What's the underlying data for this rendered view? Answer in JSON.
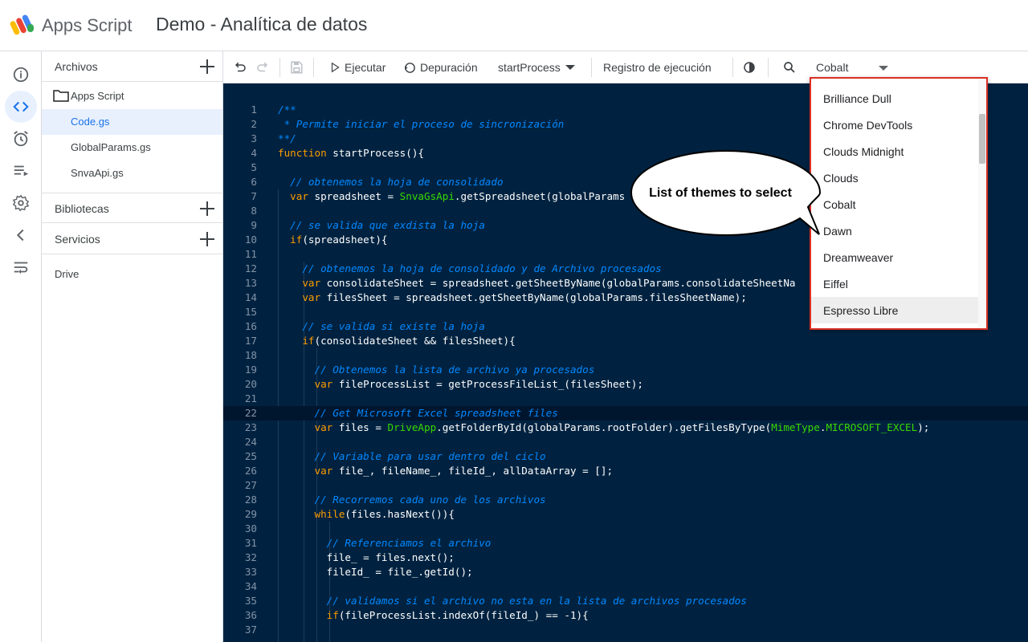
{
  "header": {
    "app_name": "Apps Script",
    "project_title": "Demo - Analítica de datos"
  },
  "rail": {
    "items": [
      {
        "icon": "info-icon",
        "label": "Overview"
      },
      {
        "icon": "code-icon",
        "label": "Editor"
      },
      {
        "icon": "alarm-clock-icon",
        "label": "Triggers"
      },
      {
        "icon": "executions-icon",
        "label": "Executions"
      },
      {
        "icon": "gear-icon",
        "label": "Settings"
      },
      {
        "icon": "chevron-left-icon",
        "label": "Collapse"
      },
      {
        "icon": "wrap-text-icon",
        "label": "Wrap"
      }
    ]
  },
  "files": {
    "section_title": "Archivos",
    "folder": "Apps Script",
    "items": [
      "Code.gs",
      "GlobalParams.gs",
      "SnvaApi.gs"
    ],
    "selected": "Code.gs",
    "libraries_title": "Bibliotecas",
    "services_title": "Servicios",
    "services_items": [
      "Drive"
    ]
  },
  "toolbar": {
    "run_label": "Ejecutar",
    "debug_label": "Depuración",
    "function_name": "startProcess",
    "log_label": "Registro de ejecución",
    "theme_value": "Cobalt"
  },
  "theme_dropdown": {
    "options": [
      "Brilliance Dull",
      "Chrome DevTools",
      "Clouds Midnight",
      "Clouds",
      "Cobalt",
      "Dawn",
      "Dreamweaver",
      "Eiffel",
      "Espresso Libre"
    ],
    "highlighted": "Espresso Libre",
    "border_color": "#d93025"
  },
  "callout": {
    "text": "List of themes to select"
  },
  "editor": {
    "theme_colors": {
      "background": "#002240",
      "comment": "#0088ff",
      "keyword": "#ff9d00",
      "global": "#3ad900"
    },
    "current_line": 22,
    "lines": [
      {
        "n": "1",
        "t": [
          [
            "c",
            "/**"
          ]
        ]
      },
      {
        "n": "2",
        "t": [
          [
            "c",
            " * Permite iniciar el proceso de sincronización"
          ]
        ]
      },
      {
        "n": "3",
        "t": [
          [
            "c",
            "**/"
          ]
        ]
      },
      {
        "n": "4",
        "t": [
          [
            "k",
            "function"
          ],
          [
            "p",
            " startProcess(){"
          ]
        ]
      },
      {
        "n": "5",
        "t": []
      },
      {
        "n": "6",
        "t": [
          [
            "p",
            "  "
          ],
          [
            "c",
            "// obtenemos la hoja de consolidado"
          ]
        ]
      },
      {
        "n": "7",
        "t": [
          [
            "p",
            "  "
          ],
          [
            "k",
            "var"
          ],
          [
            "p",
            " spreadsheet = "
          ],
          [
            "g",
            "SnvaGsApi"
          ],
          [
            "p",
            ".getSpreadsheet(globalParams"
          ]
        ]
      },
      {
        "n": "8",
        "t": []
      },
      {
        "n": "9",
        "t": [
          [
            "p",
            "  "
          ],
          [
            "c",
            "// se valida que exdista la hoja"
          ]
        ]
      },
      {
        "n": "10",
        "t": [
          [
            "p",
            "  "
          ],
          [
            "k",
            "if"
          ],
          [
            "p",
            "(spreadsheet){"
          ]
        ]
      },
      {
        "n": "11",
        "t": []
      },
      {
        "n": "12",
        "t": [
          [
            "p",
            "    "
          ],
          [
            "c",
            "// obtenemos la hoja de consolidado y de Archivo procesados"
          ]
        ]
      },
      {
        "n": "13",
        "t": [
          [
            "p",
            "    "
          ],
          [
            "k",
            "var"
          ],
          [
            "p",
            " consolidateSheet = spreadsheet.getSheetByName(globalParams.consolidateSheetNa"
          ]
        ]
      },
      {
        "n": "14",
        "t": [
          [
            "p",
            "    "
          ],
          [
            "k",
            "var"
          ],
          [
            "p",
            " filesSheet = spreadsheet.getSheetByName(globalParams.filesSheetName);"
          ]
        ]
      },
      {
        "n": "15",
        "t": []
      },
      {
        "n": "16",
        "t": [
          [
            "p",
            "    "
          ],
          [
            "c",
            "// se valida si existe la hoja"
          ]
        ]
      },
      {
        "n": "17",
        "t": [
          [
            "p",
            "    "
          ],
          [
            "k",
            "if"
          ],
          [
            "p",
            "(consolidateSheet && filesSheet){"
          ]
        ]
      },
      {
        "n": "18",
        "t": []
      },
      {
        "n": "19",
        "t": [
          [
            "p",
            "      "
          ],
          [
            "c",
            "// Obtenemos la lista de archivo ya procesados"
          ]
        ]
      },
      {
        "n": "20",
        "t": [
          [
            "p",
            "      "
          ],
          [
            "k",
            "var"
          ],
          [
            "p",
            " fileProcessList = getProcessFileList_(filesSheet);"
          ]
        ]
      },
      {
        "n": "21",
        "t": []
      },
      {
        "n": "22",
        "t": [
          [
            "p",
            "      "
          ],
          [
            "c",
            "// Get Microsoft Excel spreadsheet files"
          ]
        ]
      },
      {
        "n": "23",
        "t": [
          [
            "p",
            "      "
          ],
          [
            "k",
            "var"
          ],
          [
            "p",
            " files = "
          ],
          [
            "g",
            "DriveApp"
          ],
          [
            "p",
            ".getFolderById(globalParams.rootFolder).getFilesByType("
          ],
          [
            "g",
            "MimeType"
          ],
          [
            "p",
            "."
          ],
          [
            "g",
            "MICROSOFT_EXCEL"
          ],
          [
            "p",
            ");"
          ]
        ]
      },
      {
        "n": "24",
        "t": []
      },
      {
        "n": "25",
        "t": [
          [
            "p",
            "      "
          ],
          [
            "c",
            "// Variable para usar dentro del ciclo"
          ]
        ]
      },
      {
        "n": "26",
        "t": [
          [
            "p",
            "      "
          ],
          [
            "k",
            "var"
          ],
          [
            "p",
            " file_, fileName_, fileId_, allDataArray = [];"
          ]
        ]
      },
      {
        "n": "27",
        "t": []
      },
      {
        "n": "28",
        "t": [
          [
            "p",
            "      "
          ],
          [
            "c",
            "// Recorremos cada uno de los archivos"
          ]
        ]
      },
      {
        "n": "29",
        "t": [
          [
            "p",
            "      "
          ],
          [
            "k",
            "while"
          ],
          [
            "p",
            "(files.hasNext()){"
          ]
        ]
      },
      {
        "n": "30",
        "t": []
      },
      {
        "n": "31",
        "t": [
          [
            "p",
            "        "
          ],
          [
            "c",
            "// Referenciamos el archivo"
          ]
        ]
      },
      {
        "n": "32",
        "t": [
          [
            "p",
            "        file_ = files.next();"
          ]
        ]
      },
      {
        "n": "33",
        "t": [
          [
            "p",
            "        fileId_ = file_.getId();"
          ]
        ]
      },
      {
        "n": "34",
        "t": []
      },
      {
        "n": "35",
        "t": [
          [
            "p",
            "        "
          ],
          [
            "c",
            "// validamos si el archivo no esta en la lista de archivos procesados"
          ]
        ]
      },
      {
        "n": "36",
        "t": [
          [
            "p",
            "        "
          ],
          [
            "k",
            "if"
          ],
          [
            "p",
            "(fileProcessList.indexOf(fileId_) == -1){"
          ]
        ]
      },
      {
        "n": "37",
        "t": []
      }
    ]
  }
}
